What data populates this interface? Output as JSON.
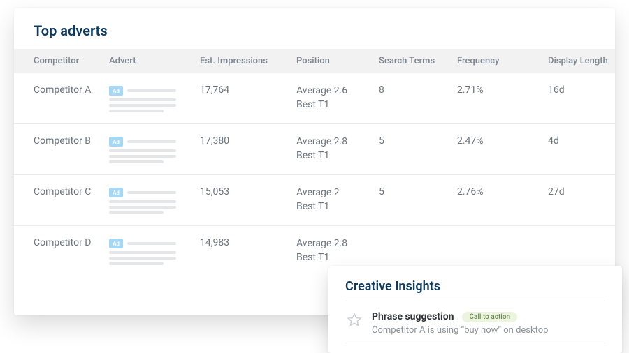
{
  "card": {
    "title": "Top adverts",
    "columns": {
      "competitor": "Competitor",
      "advert": "Advert",
      "impressions": "Est. Impressions",
      "position": "Position",
      "search_terms": "Search  Terms",
      "frequency": "Frequency",
      "display_length": "Display Length"
    },
    "advert_badge": "Ad",
    "rows": [
      {
        "competitor": "Competitor A",
        "impressions": "17,764",
        "position_avg": "Average 2.6",
        "position_best": "Best T1",
        "search_terms": "8",
        "frequency": "2.71%",
        "display_length": "16d"
      },
      {
        "competitor": "Competitor B",
        "impressions": "17,380",
        "position_avg": "Average 2.8",
        "position_best": "Best T1",
        "search_terms": "5",
        "frequency": "2.47%",
        "display_length": "4d"
      },
      {
        "competitor": "Competitor C",
        "impressions": "15,053",
        "position_avg": "Average 2",
        "position_best": "Best T1",
        "search_terms": "5",
        "frequency": "2.76%",
        "display_length": "27d"
      },
      {
        "competitor": "Competitor D",
        "impressions": "14,983",
        "position_avg": "Average 2.8",
        "position_best": "Best T1",
        "search_terms": "",
        "frequency": "",
        "display_length": ""
      }
    ]
  },
  "insights": {
    "title": "Creative Insights",
    "item": {
      "name": "Phrase suggestion",
      "badge": "Call to action",
      "description": "Competitor A is using “buy now” on desktop"
    }
  }
}
